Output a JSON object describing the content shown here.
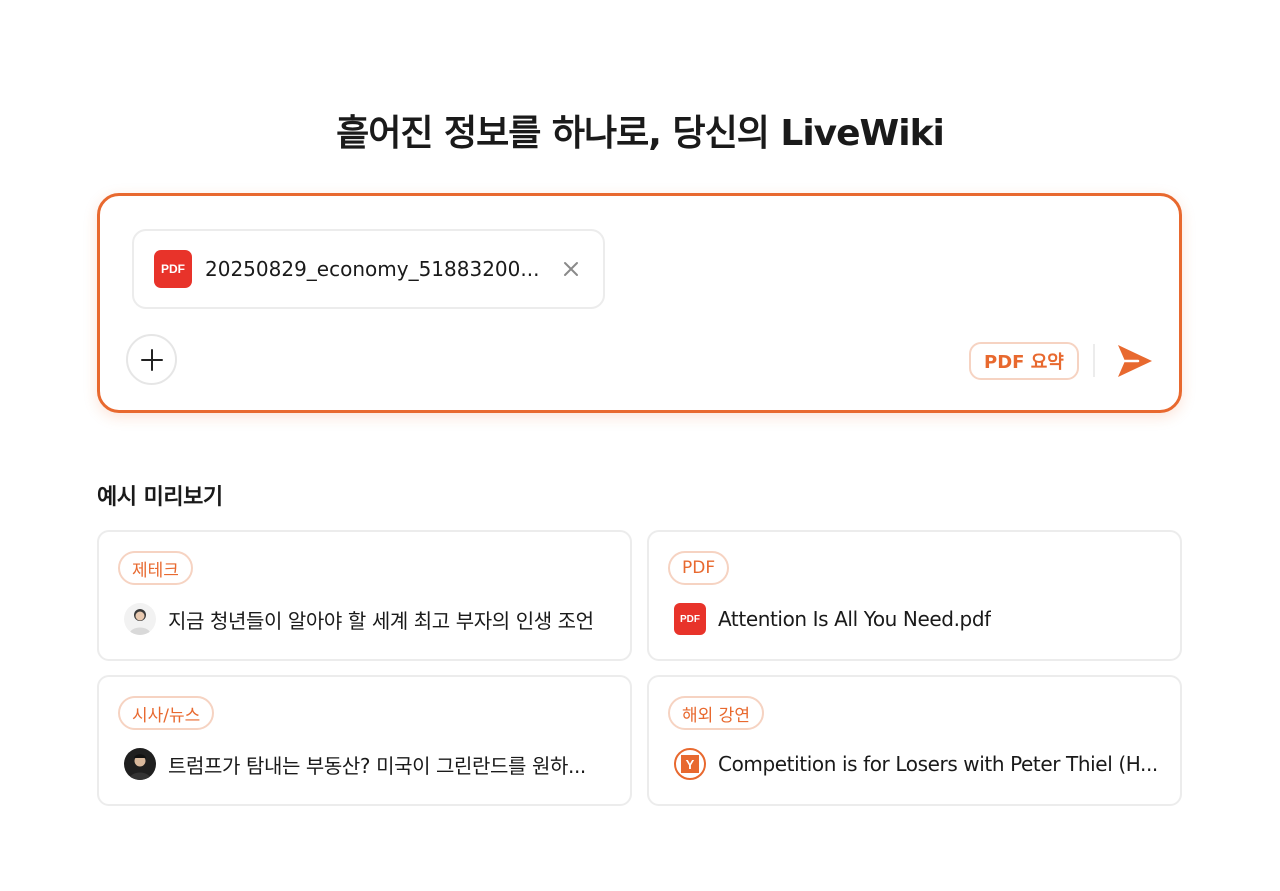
{
  "headline": "흩어진 정보를 하나로, 당신의 LiveWiki",
  "composer": {
    "attachment": {
      "badge": "PDF",
      "file_name": "20250829_economy_51883200..."
    },
    "action_chip": "PDF 요약",
    "accent_color": "#e8692f"
  },
  "examples": {
    "section_title": "예시 미리보기",
    "cards": [
      {
        "tag": "제테크",
        "title": "지금 청년들이 알아야 할 세계 최고 부자의 인생 조언",
        "icon": "person-avatar-icon"
      },
      {
        "tag": "PDF",
        "title": "Attention Is All You Need.pdf",
        "icon": "pdf-file-icon",
        "icon_text": "PDF"
      },
      {
        "tag": "시사/뉴스",
        "title": "트럼프가 탐내는 부동산? 미국이 그린란드를 원하...",
        "icon": "person-avatar-icon"
      },
      {
        "tag": "해외 강연",
        "title": "Competition is for Losers with Peter Thiel (H...",
        "icon": "y-combinator-icon",
        "icon_text": "Y"
      }
    ]
  }
}
